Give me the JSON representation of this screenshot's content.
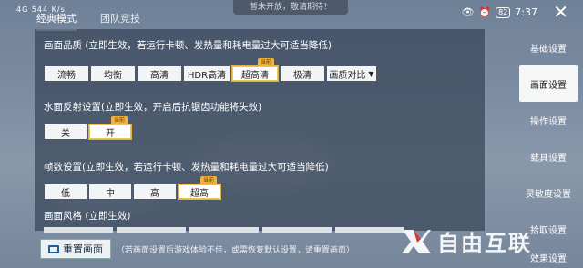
{
  "statusbar": {
    "left_text": "4G 544 K/s",
    "battery": "82",
    "time": "7:37"
  },
  "toast": "暂未开放，敬请期待！",
  "top_tabs": [
    {
      "label": "经典模式"
    },
    {
      "label": "团队竞技"
    }
  ],
  "graphics_quality": {
    "title": "画面品质 (立即生效，若运行卡顿、发热量和耗电量过大可适当降低)",
    "options": [
      "流畅",
      "均衡",
      "高清",
      "HDR高清",
      "超高清",
      "极清",
      "画质对比"
    ],
    "selected": "超高清",
    "tag": "当前"
  },
  "water_reflection": {
    "title": "水面反射设置(立即生效，开启后抗锯齿功能将失效)",
    "options": [
      "关",
      "开"
    ],
    "selected": "开",
    "tag": "当前"
  },
  "frame_rate": {
    "title": "帧数设置(立即生效，若运行卡顿、发热量和耗电量过大可适当降低)",
    "options": [
      "低",
      "中",
      "高",
      "超高"
    ],
    "selected": "超高",
    "tag": "当前"
  },
  "graphics_style": {
    "title": "画面风格 (立即生效)"
  },
  "sidebar": [
    {
      "label": "基础设置"
    },
    {
      "label": "画面设置"
    },
    {
      "label": "操作设置"
    },
    {
      "label": "载具设置"
    },
    {
      "label": "灵敏度设置"
    },
    {
      "label": "拾取设置"
    },
    {
      "label": "效果设置"
    }
  ],
  "sidebar_active": "画面设置",
  "reset": {
    "label": "重置画面",
    "note": "（若画面设置后游戏体验不佳，或需恢复默认设置，请重置画面）"
  },
  "watermark": {
    "text": "自由互联"
  },
  "colors": {
    "accent_gold": "#f1b43a",
    "panel_bg": "#3c4a5e"
  }
}
